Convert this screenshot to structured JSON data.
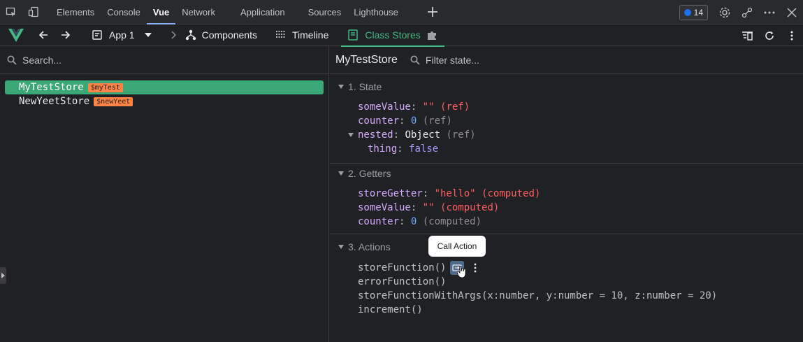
{
  "devtools": {
    "tabs": [
      {
        "label": "Elements"
      },
      {
        "label": "Console"
      },
      {
        "label": "Vue"
      },
      {
        "label": "Network"
      },
      {
        "label": "Application"
      },
      {
        "label": "Sources"
      },
      {
        "label": "Lighthouse"
      }
    ],
    "active_tab": "Vue",
    "issues_count": "14"
  },
  "vue_toolbar": {
    "app_label": "App 1",
    "components_label": "Components",
    "timeline_label": "Timeline",
    "class_stores_label": "Class Stores"
  },
  "left_pane": {
    "search_placeholder": "Search...",
    "stores": [
      {
        "name": "MyTestStore",
        "tag": "$myTest",
        "selected": true
      },
      {
        "name": "NewYeetStore",
        "tag": "$newYeet",
        "selected": false
      }
    ]
  },
  "right_pane": {
    "title": "MyTestStore",
    "filter_placeholder": "Filter state...",
    "state": {
      "heading": "1. State",
      "rows": [
        {
          "key": "someValue",
          "value": "\"\"",
          "meta": "(ref)"
        },
        {
          "key": "counter",
          "value": "0",
          "meta": "(ref)"
        },
        {
          "key": "nested",
          "value": "Object",
          "meta": "(ref)"
        },
        {
          "key": "thing",
          "value": "false",
          "meta": ""
        }
      ]
    },
    "getters": {
      "heading": "2. Getters",
      "rows": [
        {
          "key": "storeGetter",
          "value": "\"hello\"",
          "meta": "(computed)"
        },
        {
          "key": "someValue",
          "value": "\"\"",
          "meta": "(computed)"
        },
        {
          "key": "counter",
          "value": "0",
          "meta": "(computed)"
        }
      ]
    },
    "actions": {
      "heading": "3. Actions",
      "items": [
        "storeFunction()",
        "errorFunction()",
        "storeFunctionWithArgs(x:number, y:number = 10, z:number = 20)",
        "increment()"
      ]
    },
    "tooltip": "Call Action"
  },
  "colors": {
    "vue_green": "#42b883",
    "selected_row": "#3ba776",
    "tag_orange": "#ff8344",
    "string_red": "#ff5f5f"
  }
}
